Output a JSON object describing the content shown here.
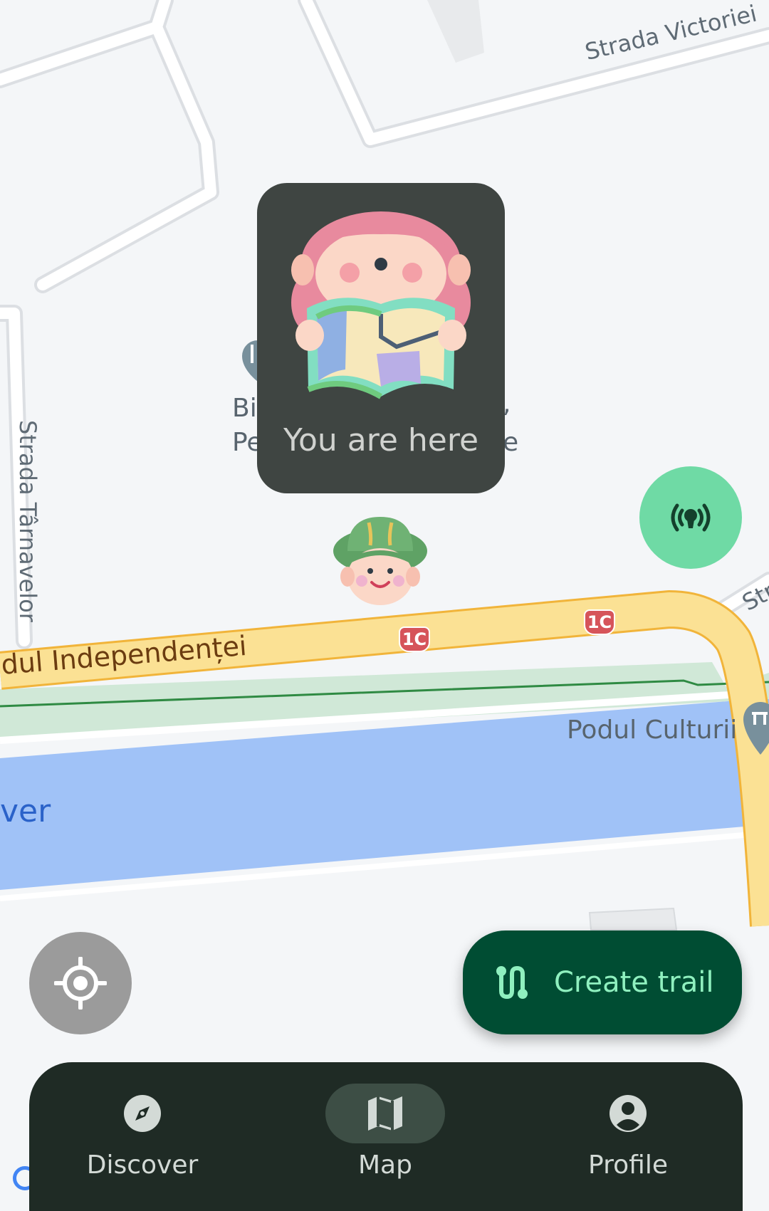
{
  "map": {
    "streets": {
      "victoriei": "Strada Victoriei",
      "tarnavelor": "Strada Târnavelor",
      "boulevard": "dul Independenței",
      "partial_right": "Str"
    },
    "route_badges": [
      "1C",
      "1C"
    ],
    "poi": {
      "partial_line1_left": "Bi",
      "partial_line2_left": "Pe",
      "partial_line1_right": ",",
      "partial_line2_right": "e",
      "bridge": "Podul Culturii"
    },
    "river_partial": "ver"
  },
  "tooltip": {
    "text": "You are here"
  },
  "actions": {
    "create_trail": "Create trail"
  },
  "nav": {
    "items": [
      {
        "label": "Discover",
        "icon": "compass-icon",
        "active": false
      },
      {
        "label": "Map",
        "icon": "map-icon",
        "active": true
      },
      {
        "label": "Profile",
        "icon": "account-circle-icon",
        "active": false
      }
    ]
  },
  "colors": {
    "accent_green": "#6fdaa5",
    "dark_green": "#004d33",
    "nav_bg": "#1f2b25",
    "tooltip_bg": "#3f4542",
    "river": "#a0c2f7",
    "boulevard": "#fbe194"
  }
}
